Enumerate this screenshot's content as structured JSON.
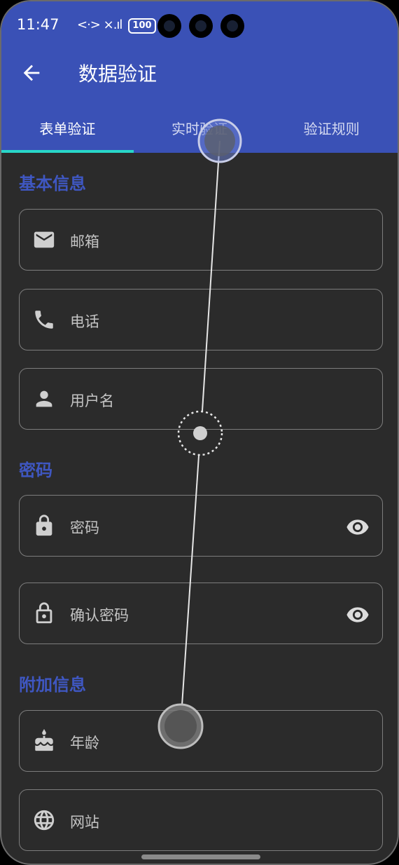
{
  "status_bar": {
    "time": "11:47",
    "signal_text": "<·> ×.ıl",
    "battery": "100"
  },
  "app_bar": {
    "title": "数据验证",
    "back_icon": "arrow-left-icon"
  },
  "tabs": [
    {
      "label": "表单验证",
      "active": true
    },
    {
      "label": "实时验证",
      "active": false
    },
    {
      "label": "验证规则",
      "active": false
    }
  ],
  "sections": {
    "basic": "基本信息",
    "password": "密码",
    "extra": "附加信息"
  },
  "fields": {
    "email": {
      "label": "邮箱",
      "icon": "mail-icon"
    },
    "phone": {
      "label": "电话",
      "icon": "phone-icon"
    },
    "username": {
      "label": "用户名",
      "icon": "person-icon"
    },
    "password": {
      "label": "密码",
      "icon": "lock-icon",
      "trailing": "eye-icon"
    },
    "confirm_password": {
      "label": "确认密码",
      "icon": "lock-open-icon",
      "trailing": "eye-icon"
    },
    "age": {
      "label": "年龄",
      "icon": "cake-icon"
    },
    "website": {
      "label": "网站",
      "icon": "globe-icon"
    }
  },
  "colors": {
    "header": "#3a51b6",
    "accent_underline": "#28d6c8",
    "section_title": "#3f57c2",
    "background": "#2b2b2b"
  }
}
